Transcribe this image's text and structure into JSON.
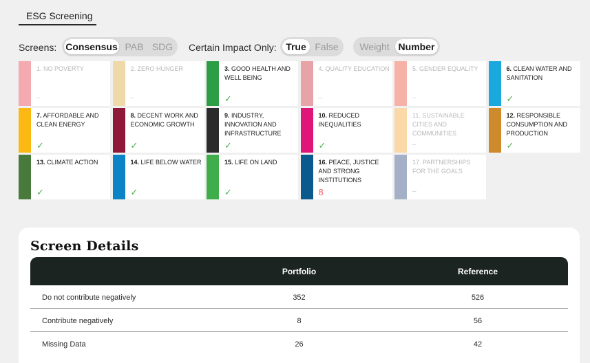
{
  "tab": {
    "label": "ESG Screening"
  },
  "controls": {
    "screens_label": "Screens:",
    "screens_options": [
      "Consensus",
      "PAB",
      "SDG"
    ],
    "screens_selected": "Consensus",
    "impact_label": "Certain Impact Only:",
    "impact_options": [
      "True",
      "False"
    ],
    "impact_selected": "True",
    "mode_options": [
      "Weight",
      "Number"
    ],
    "mode_selected": "Number"
  },
  "sdgs": [
    {
      "num": "1.",
      "title": "NO POVERTY",
      "color": "#f4aab0",
      "status": "dash",
      "value": "–",
      "dim": true
    },
    {
      "num": "2.",
      "title": "ZERO HUNGER",
      "color": "#efd9a8",
      "status": "dash",
      "value": "–",
      "dim": true
    },
    {
      "num": "3.",
      "title": "GOOD HEALTH AND WELL BEING",
      "color": "#2e9e46",
      "status": "check",
      "value": "✓",
      "dim": false
    },
    {
      "num": "4.",
      "title": "QUALITY EDUCATION",
      "color": "#e8a3a8",
      "status": "dash",
      "value": "–",
      "dim": true
    },
    {
      "num": "5.",
      "title": "GENDER EQUALITY",
      "color": "#f7b2a8",
      "status": "dash",
      "value": "–",
      "dim": true
    },
    {
      "num": "6.",
      "title": "CLEAN WATER AND SANITATION",
      "color": "#1aa9dd",
      "status": "check",
      "value": "✓",
      "dim": false
    },
    {
      "num": "7.",
      "title": "AFFORDABLE AND CLEAN ENERGY",
      "color": "#fcb913",
      "status": "check",
      "value": "✓",
      "dim": false
    },
    {
      "num": "8.",
      "title": "DECENT WORK AND ECONOMIC GROWTH",
      "color": "#8f1838",
      "status": "check",
      "value": "✓",
      "dim": false
    },
    {
      "num": "9.",
      "title": "INDUSTRY, INNOVATION AND INFRASTRUCTURE",
      "color": "#2b2b2b",
      "status": "check",
      "value": "✓",
      "dim": false
    },
    {
      "num": "10.",
      "title": "REDUCED INEQUALITIES",
      "color": "#e0157a",
      "status": "check",
      "value": "✓",
      "dim": false
    },
    {
      "num": "11.",
      "title": "SUSTAINABLE CITIES AND COMMUNITIES",
      "color": "#fbd8a8",
      "status": "dash",
      "value": "–",
      "dim": true
    },
    {
      "num": "12.",
      "title": "RESPONSIBLE CONSUMPTION AND PRODUCTION",
      "color": "#cd8b2b",
      "status": "check",
      "value": "✓",
      "dim": false
    },
    {
      "num": "13.",
      "title": "CLIMATE ACTION",
      "color": "#487a3c",
      "status": "check",
      "value": "✓",
      "dim": false
    },
    {
      "num": "14.",
      "title": "LIFE BELOW WATER",
      "color": "#0b83c6",
      "status": "check",
      "value": "✓",
      "dim": false
    },
    {
      "num": "15.",
      "title": "LIFE ON LAND",
      "color": "#3fae4a",
      "status": "check",
      "value": "✓",
      "dim": false
    },
    {
      "num": "16.",
      "title": "PEACE, JUSTICE AND STRONG INSTITUTIONS",
      "color": "#0b5a8e",
      "status": "num",
      "value": "8",
      "dim": false
    },
    {
      "num": "17.",
      "title": "PARTNERSHIPS FOR THE GOALS",
      "color": "#a4b0c6",
      "status": "dash",
      "value": "–",
      "dim": true
    }
  ],
  "details": {
    "title": "Screen Details",
    "headers": [
      "",
      "Portfolio",
      "Reference"
    ],
    "rows": [
      {
        "label": "Do not contribute negatively",
        "portfolio": "352",
        "reference": "526"
      },
      {
        "label": "Contribute negatively",
        "portfolio": "8",
        "reference": "56"
      },
      {
        "label": "Missing Data",
        "portfolio": "26",
        "reference": "42"
      }
    ]
  }
}
